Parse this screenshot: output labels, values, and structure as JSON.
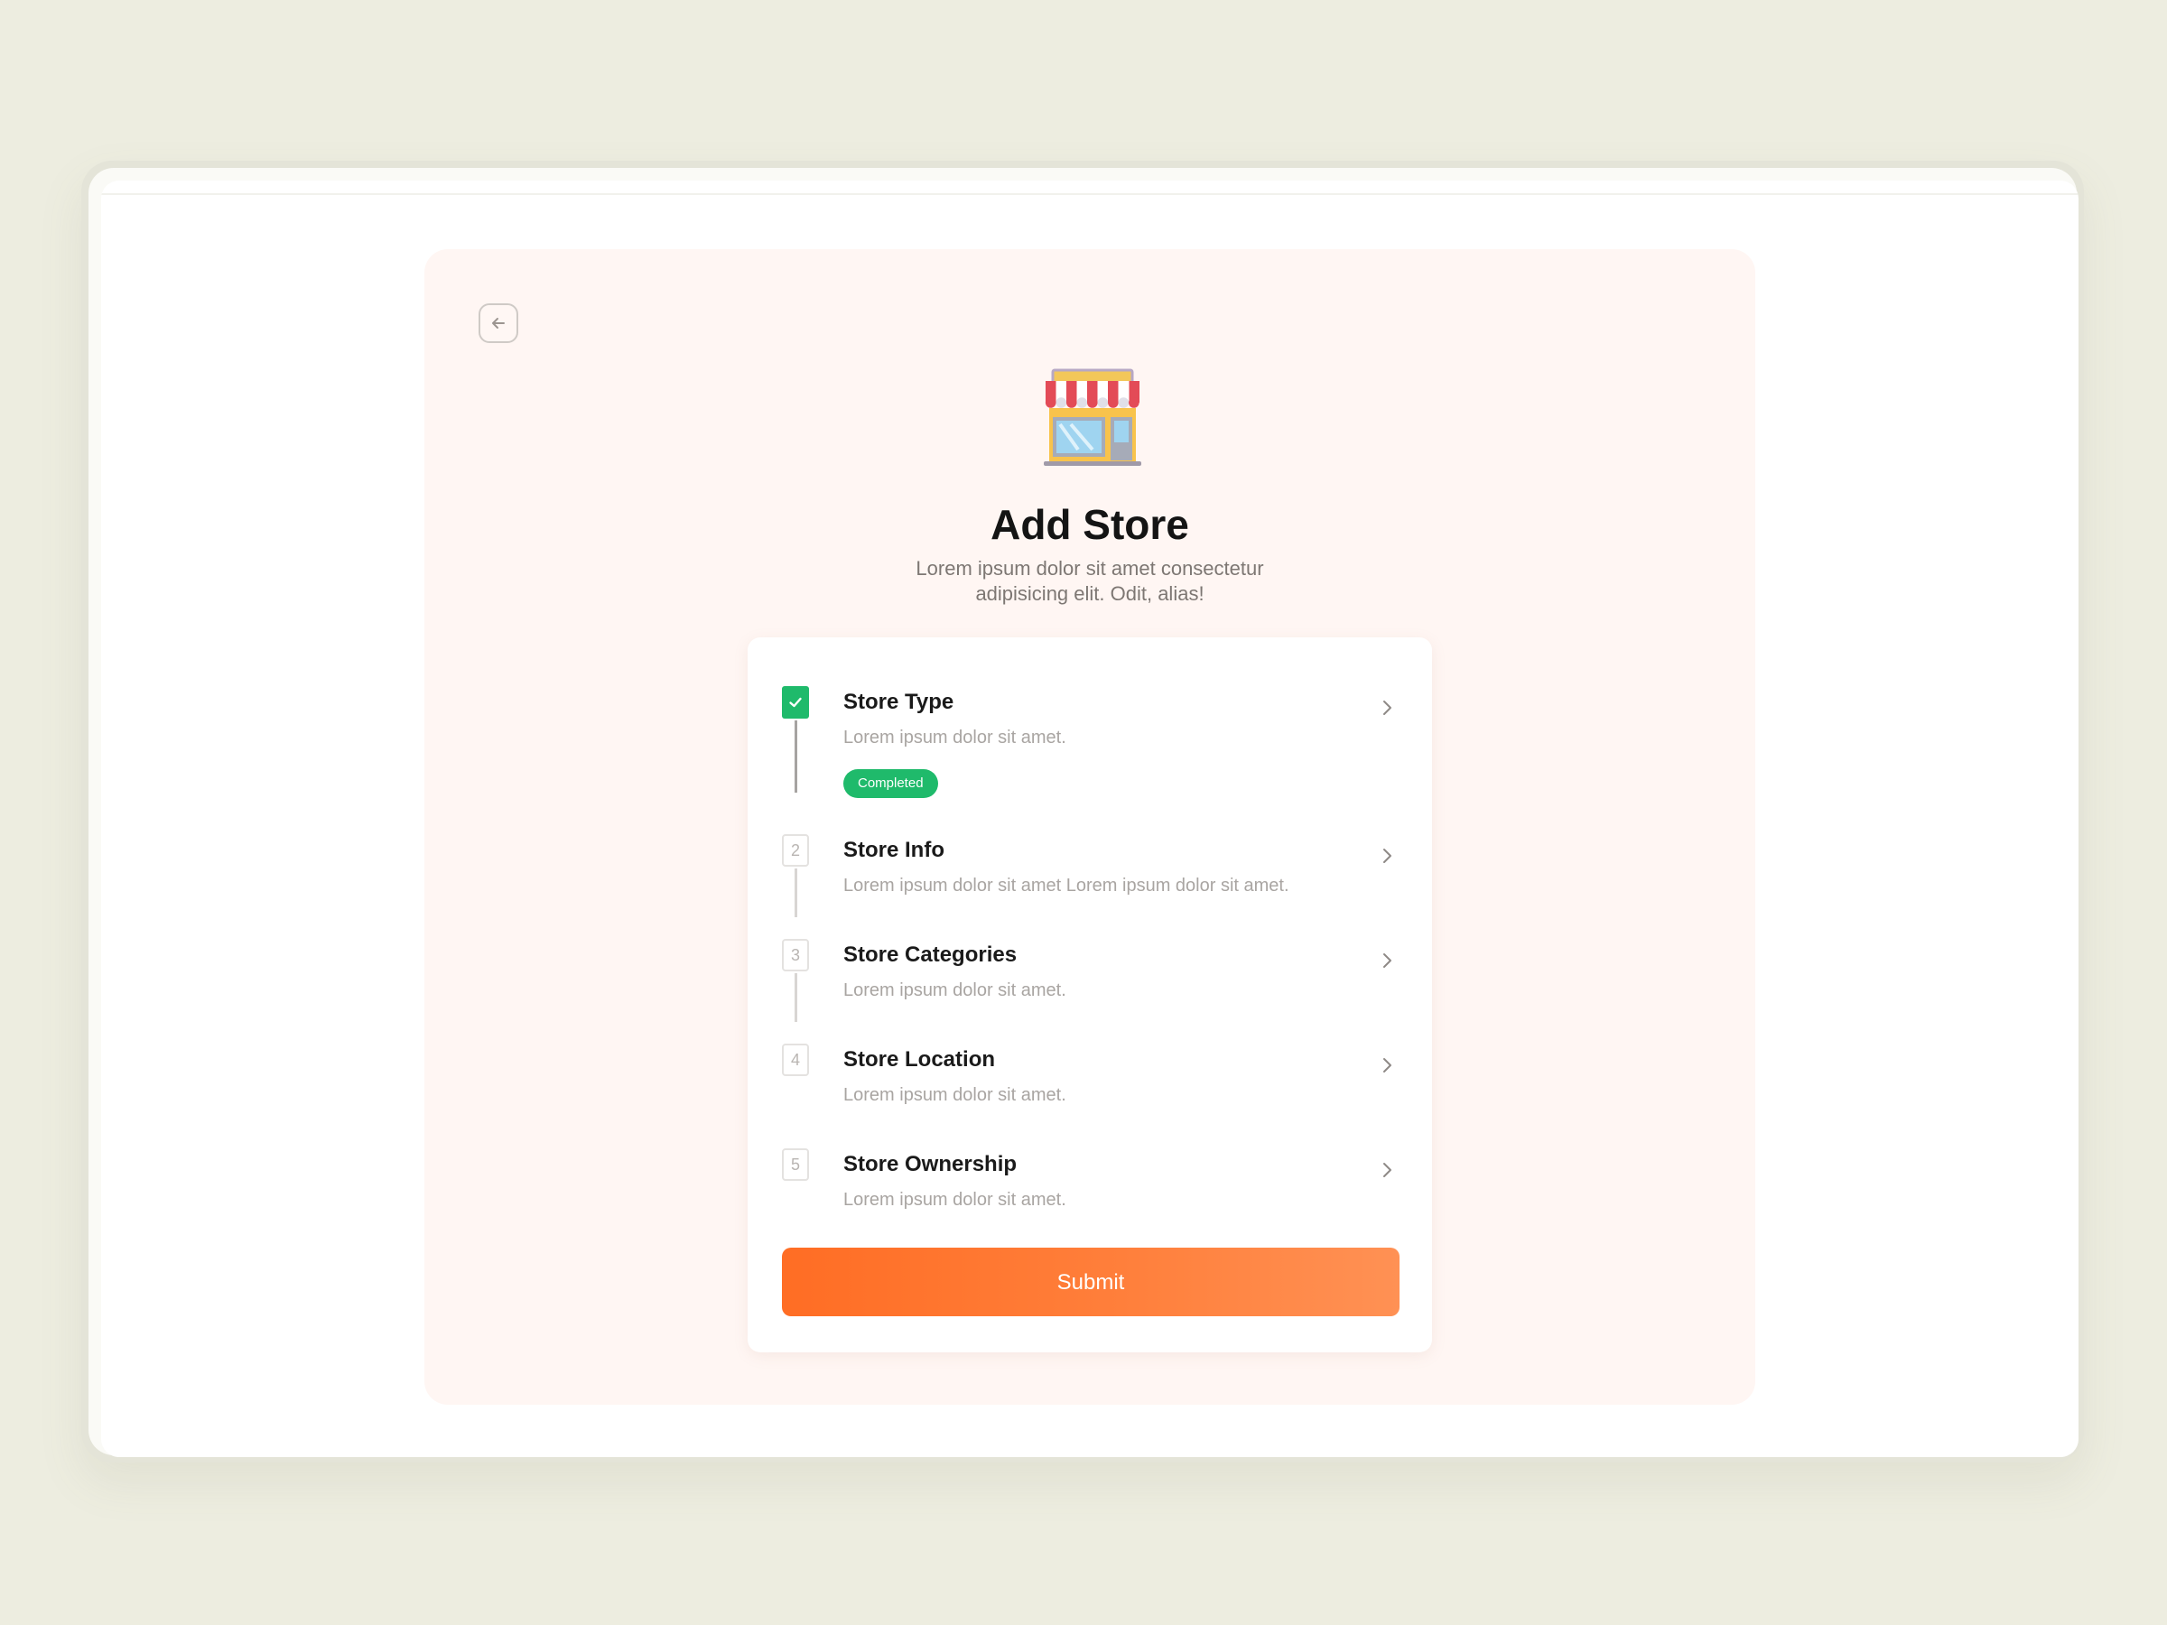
{
  "header": {
    "back_label": "",
    "title": "Add Store",
    "subtitle_line1": "Lorem ipsum dolor sit amet consectetur",
    "subtitle_line2": "adipisicing elit. Odit, alias!"
  },
  "icons": {
    "back": "arrow-left-icon",
    "store": "storefront-illustration",
    "check": "check-icon",
    "chevron": "chevron-right-icon"
  },
  "steps": [
    {
      "number": "",
      "title": "Store Type",
      "description": "Lorem ipsum dolor sit amet.",
      "status": "Completed"
    },
    {
      "number": "2",
      "title": "Store Info",
      "description": "Lorem ipsum dolor sit amet Lorem ipsum dolor sit amet."
    },
    {
      "number": "3",
      "title": "Store Categories",
      "description": "Lorem ipsum dolor sit amet."
    },
    {
      "number": "4",
      "title": "Store Location",
      "description": "Lorem ipsum dolor sit amet."
    },
    {
      "number": "5",
      "title": "Store Ownership",
      "description": "Lorem ipsum dolor sit amet."
    }
  ],
  "submit_label": "Submit",
  "colors": {
    "page_background": "#edede0",
    "panel_background": "#fff6f3",
    "accent_orange": "#ff7a30",
    "success_green": "#1fba6b"
  }
}
